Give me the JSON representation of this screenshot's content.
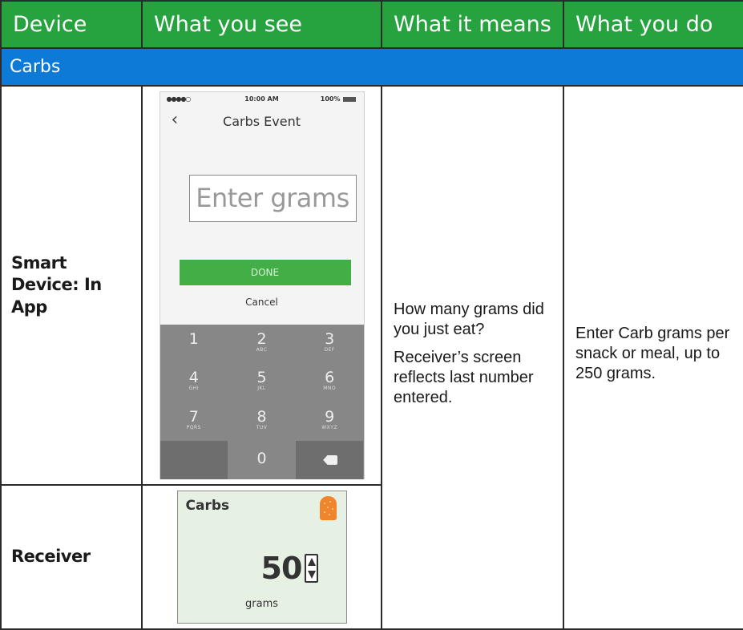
{
  "headers": [
    "Device",
    "What you see",
    "What it means",
    "What you do"
  ],
  "section": "Carbs",
  "rows": [
    {
      "device": "Smart Device: In App"
    },
    {
      "device": "Receiver"
    }
  ],
  "meaning": [
    "How many grams did you just eat?",
    "Receiver’s screen reflects last number entered."
  ],
  "action": "Enter Carb grams per snack or meal, up to 250 grams.",
  "phone": {
    "status_dots": "●●●●○",
    "time": "10:00 AM",
    "battery": "100%",
    "back_icon": "chevron-left-icon",
    "title": "Carbs Event",
    "input_placeholder": "Enter grams",
    "done_label": "DONE",
    "cancel_label": "Cancel",
    "keys": [
      {
        "num": "1",
        "letters": ""
      },
      {
        "num": "2",
        "letters": "ABC"
      },
      {
        "num": "3",
        "letters": "DEF"
      },
      {
        "num": "4",
        "letters": "GHI"
      },
      {
        "num": "5",
        "letters": "JKL"
      },
      {
        "num": "6",
        "letters": "MNO"
      },
      {
        "num": "7",
        "letters": "PQRS"
      },
      {
        "num": "8",
        "letters": "TUV"
      },
      {
        "num": "9",
        "letters": "WXYZ"
      },
      {
        "num": "0",
        "letters": ""
      }
    ],
    "delete_icon": "backspace-icon"
  },
  "receiver": {
    "title": "Carbs",
    "icon": "carbs-cookie-icon",
    "value": "50",
    "unit": "grams"
  },
  "colors": {
    "header": "#26a23f",
    "section": "#0d7ad8",
    "done_button": "#43ae45",
    "keypad": "#878787",
    "receiver_bg": "#e6f1e4",
    "carb_icon": "#f0852b"
  }
}
